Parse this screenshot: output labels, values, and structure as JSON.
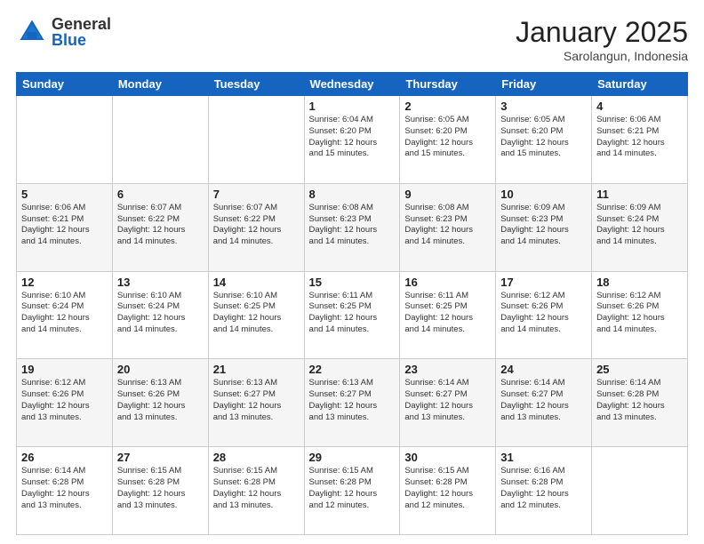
{
  "header": {
    "logo_general": "General",
    "logo_blue": "Blue",
    "month": "January 2025",
    "location": "Sarolangun, Indonesia"
  },
  "days_of_week": [
    "Sunday",
    "Monday",
    "Tuesday",
    "Wednesday",
    "Thursday",
    "Friday",
    "Saturday"
  ],
  "weeks": [
    [
      {
        "day": "",
        "info": ""
      },
      {
        "day": "",
        "info": ""
      },
      {
        "day": "",
        "info": ""
      },
      {
        "day": "1",
        "info": "Sunrise: 6:04 AM\nSunset: 6:20 PM\nDaylight: 12 hours\nand 15 minutes."
      },
      {
        "day": "2",
        "info": "Sunrise: 6:05 AM\nSunset: 6:20 PM\nDaylight: 12 hours\nand 15 minutes."
      },
      {
        "day": "3",
        "info": "Sunrise: 6:05 AM\nSunset: 6:20 PM\nDaylight: 12 hours\nand 15 minutes."
      },
      {
        "day": "4",
        "info": "Sunrise: 6:06 AM\nSunset: 6:21 PM\nDaylight: 12 hours\nand 14 minutes."
      }
    ],
    [
      {
        "day": "5",
        "info": "Sunrise: 6:06 AM\nSunset: 6:21 PM\nDaylight: 12 hours\nand 14 minutes."
      },
      {
        "day": "6",
        "info": "Sunrise: 6:07 AM\nSunset: 6:22 PM\nDaylight: 12 hours\nand 14 minutes."
      },
      {
        "day": "7",
        "info": "Sunrise: 6:07 AM\nSunset: 6:22 PM\nDaylight: 12 hours\nand 14 minutes."
      },
      {
        "day": "8",
        "info": "Sunrise: 6:08 AM\nSunset: 6:23 PM\nDaylight: 12 hours\nand 14 minutes."
      },
      {
        "day": "9",
        "info": "Sunrise: 6:08 AM\nSunset: 6:23 PM\nDaylight: 12 hours\nand 14 minutes."
      },
      {
        "day": "10",
        "info": "Sunrise: 6:09 AM\nSunset: 6:23 PM\nDaylight: 12 hours\nand 14 minutes."
      },
      {
        "day": "11",
        "info": "Sunrise: 6:09 AM\nSunset: 6:24 PM\nDaylight: 12 hours\nand 14 minutes."
      }
    ],
    [
      {
        "day": "12",
        "info": "Sunrise: 6:10 AM\nSunset: 6:24 PM\nDaylight: 12 hours\nand 14 minutes."
      },
      {
        "day": "13",
        "info": "Sunrise: 6:10 AM\nSunset: 6:24 PM\nDaylight: 12 hours\nand 14 minutes."
      },
      {
        "day": "14",
        "info": "Sunrise: 6:10 AM\nSunset: 6:25 PM\nDaylight: 12 hours\nand 14 minutes."
      },
      {
        "day": "15",
        "info": "Sunrise: 6:11 AM\nSunset: 6:25 PM\nDaylight: 12 hours\nand 14 minutes."
      },
      {
        "day": "16",
        "info": "Sunrise: 6:11 AM\nSunset: 6:25 PM\nDaylight: 12 hours\nand 14 minutes."
      },
      {
        "day": "17",
        "info": "Sunrise: 6:12 AM\nSunset: 6:26 PM\nDaylight: 12 hours\nand 14 minutes."
      },
      {
        "day": "18",
        "info": "Sunrise: 6:12 AM\nSunset: 6:26 PM\nDaylight: 12 hours\nand 14 minutes."
      }
    ],
    [
      {
        "day": "19",
        "info": "Sunrise: 6:12 AM\nSunset: 6:26 PM\nDaylight: 12 hours\nand 13 minutes."
      },
      {
        "day": "20",
        "info": "Sunrise: 6:13 AM\nSunset: 6:26 PM\nDaylight: 12 hours\nand 13 minutes."
      },
      {
        "day": "21",
        "info": "Sunrise: 6:13 AM\nSunset: 6:27 PM\nDaylight: 12 hours\nand 13 minutes."
      },
      {
        "day": "22",
        "info": "Sunrise: 6:13 AM\nSunset: 6:27 PM\nDaylight: 12 hours\nand 13 minutes."
      },
      {
        "day": "23",
        "info": "Sunrise: 6:14 AM\nSunset: 6:27 PM\nDaylight: 12 hours\nand 13 minutes."
      },
      {
        "day": "24",
        "info": "Sunrise: 6:14 AM\nSunset: 6:27 PM\nDaylight: 12 hours\nand 13 minutes."
      },
      {
        "day": "25",
        "info": "Sunrise: 6:14 AM\nSunset: 6:28 PM\nDaylight: 12 hours\nand 13 minutes."
      }
    ],
    [
      {
        "day": "26",
        "info": "Sunrise: 6:14 AM\nSunset: 6:28 PM\nDaylight: 12 hours\nand 13 minutes."
      },
      {
        "day": "27",
        "info": "Sunrise: 6:15 AM\nSunset: 6:28 PM\nDaylight: 12 hours\nand 13 minutes."
      },
      {
        "day": "28",
        "info": "Sunrise: 6:15 AM\nSunset: 6:28 PM\nDaylight: 12 hours\nand 13 minutes."
      },
      {
        "day": "29",
        "info": "Sunrise: 6:15 AM\nSunset: 6:28 PM\nDaylight: 12 hours\nand 12 minutes."
      },
      {
        "day": "30",
        "info": "Sunrise: 6:15 AM\nSunset: 6:28 PM\nDaylight: 12 hours\nand 12 minutes."
      },
      {
        "day": "31",
        "info": "Sunrise: 6:16 AM\nSunset: 6:28 PM\nDaylight: 12 hours\nand 12 minutes."
      },
      {
        "day": "",
        "info": ""
      }
    ]
  ]
}
